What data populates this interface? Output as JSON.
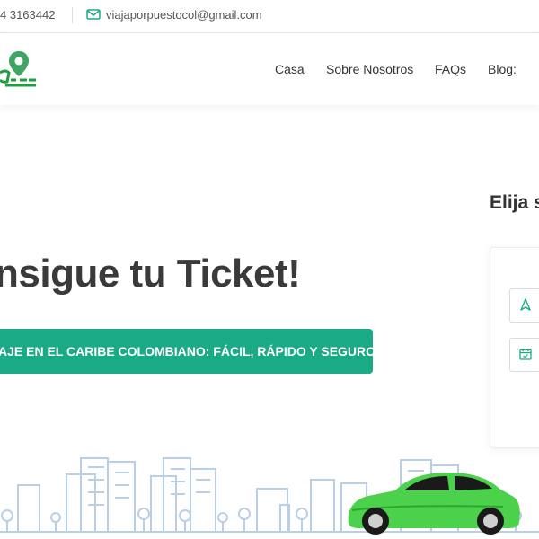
{
  "topbar": {
    "phone": "4 3163442",
    "email": "viajaporpuestocol@gmail.com"
  },
  "nav": {
    "items": [
      "Casa",
      "Sobre Nosotros",
      "FAQs",
      "Blog:"
    ]
  },
  "hero": {
    "title": "nsigue tu Ticket!",
    "cta_label": "AJE EN EL CARIBE COLOMBIANO: FÁCIL, RÁPIDO Y SEGURO"
  },
  "booking": {
    "title": "Elija s"
  },
  "icons": {
    "mail": "mail-icon",
    "logo": "map-pin-logo",
    "origin": "navigation-arrow-icon",
    "date": "calendar-icon"
  },
  "colors": {
    "brand_green": "#1aaa86",
    "car_green": "#4bd14b",
    "skyline_blue": "#b9cfe6"
  }
}
